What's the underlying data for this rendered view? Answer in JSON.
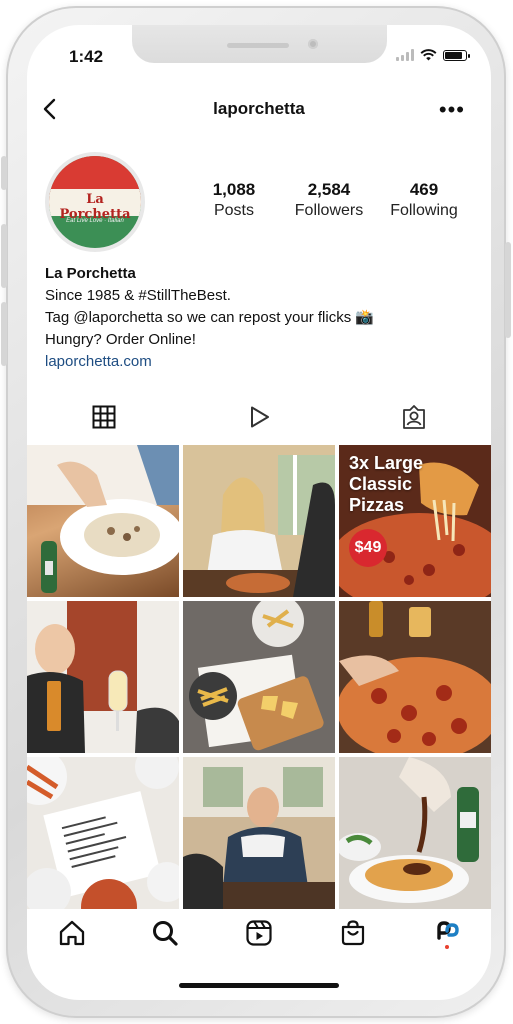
{
  "status_bar": {
    "time": "1:42"
  },
  "header": {
    "username": "laporchetta"
  },
  "profile": {
    "logo_text": "La Porchetta",
    "logo_tagline": "Eat Live Love · Italian",
    "stats": [
      {
        "value": "1,088",
        "label": "Posts"
      },
      {
        "value": "2,584",
        "label": "Followers"
      },
      {
        "value": "469",
        "label": "Following"
      }
    ],
    "name": "La Porchetta",
    "bio_lines": [
      "Since 1985 & #StillTheBest.",
      "Tag @laporchetta so we can repost your flicks 📸",
      "Hungry? Order Online!"
    ],
    "link": "laporchetta.com"
  },
  "grid_posts": [
    {
      "overlay_title": "",
      "price": ""
    },
    {
      "overlay_title": "",
      "price": ""
    },
    {
      "overlay_title": "3x Large Classic Pizzas",
      "price": "$49"
    },
    {
      "overlay_title": "",
      "price": ""
    },
    {
      "overlay_title": "",
      "price": ""
    },
    {
      "overlay_title": "",
      "price": ""
    },
    {
      "overlay_title": "",
      "price": ""
    },
    {
      "overlay_title": "",
      "price": ""
    },
    {
      "overlay_title": "",
      "price": ""
    }
  ],
  "colors": {
    "link": "#1e4d82",
    "logo_red": "#d93b33",
    "logo_green": "#3c8f55",
    "price_badge": "#d9282f",
    "avatar_dot": "#e8402f"
  },
  "icons": {
    "tabs": [
      "grid-icon",
      "reels-icon",
      "tagged-icon"
    ],
    "nav": [
      "home-icon",
      "search-icon",
      "reels-icon",
      "shop-icon",
      "profile-avatar-icon"
    ]
  }
}
